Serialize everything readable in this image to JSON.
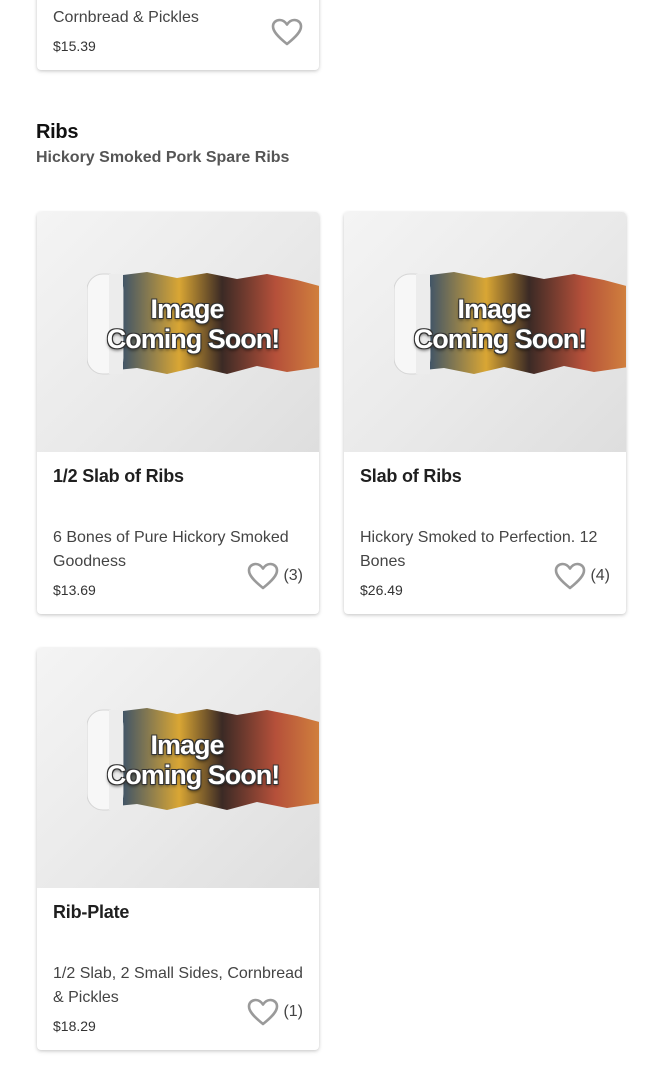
{
  "previous_item": {
    "desc": "Cornbread & Pickles",
    "price": "$15.39"
  },
  "section": {
    "title": "Ribs",
    "subtitle": "Hickory Smoked Pork Spare Ribs"
  },
  "placeholder_image": {
    "line1": "Image",
    "line2": "Coming Soon!"
  },
  "items": [
    {
      "title": "1/2 Slab of Ribs",
      "desc": "6 Bones of Pure Hickory Smoked Goodness",
      "price": "$13.69",
      "favorites": "(3)"
    },
    {
      "title": "Slab of Ribs",
      "desc": "Hickory Smoked to Perfection. 12 Bones",
      "price": "$26.49",
      "favorites": "(4)"
    },
    {
      "title": "Rib-Plate",
      "desc": "1/2 Slab, 2 Small Sides, Cornbread & Pickles",
      "price": "$18.29",
      "favorites": "(1)"
    }
  ],
  "colors": {
    "heart_outline": "#9a9a9a",
    "text": "#222222"
  },
  "icons": {
    "favorite": "heart-outline-icon"
  }
}
